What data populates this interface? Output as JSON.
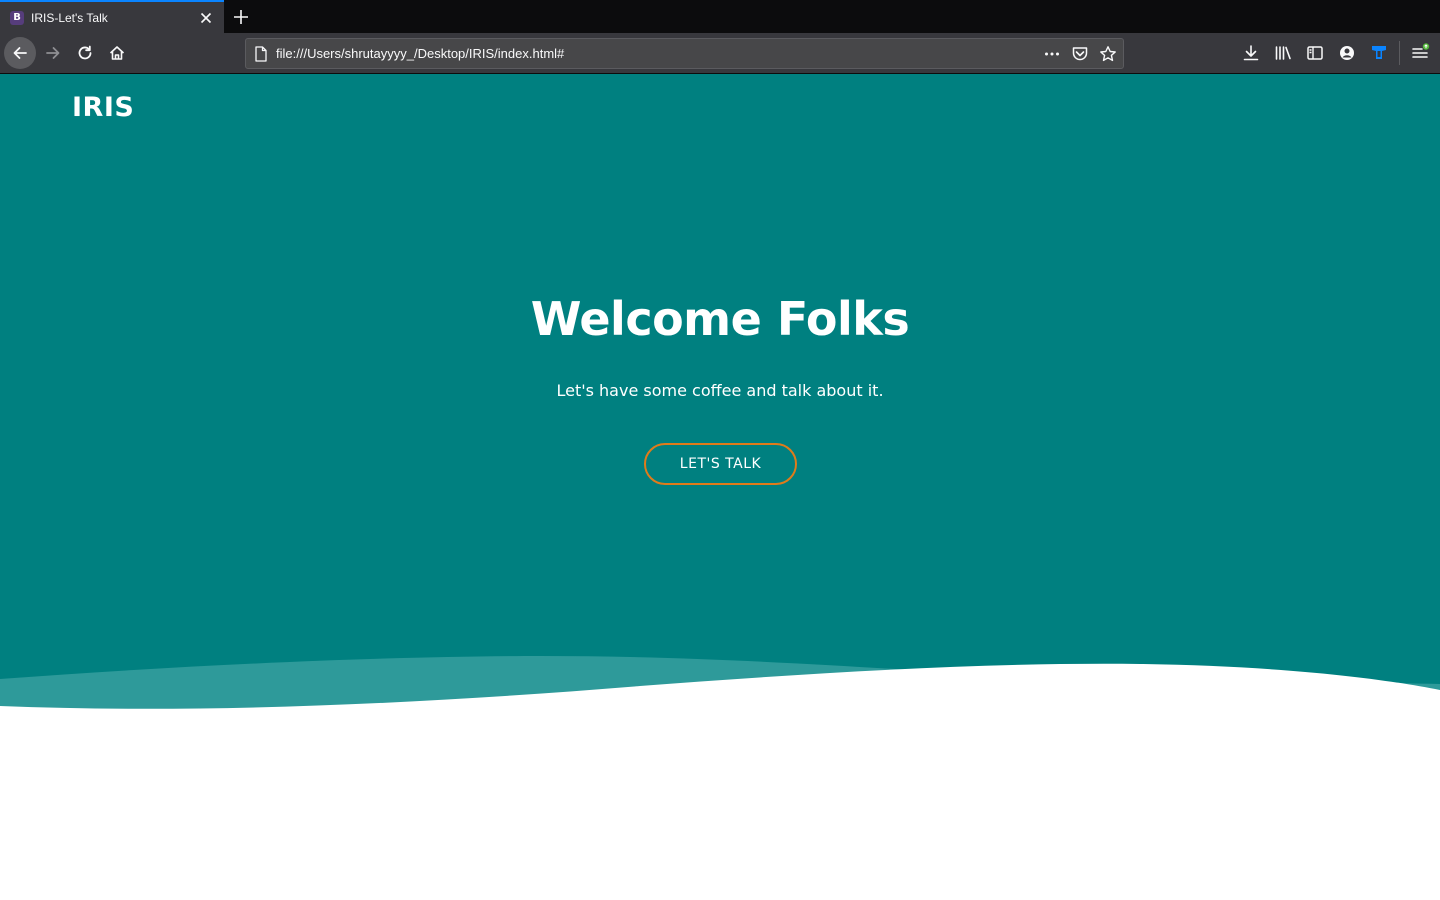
{
  "browser": {
    "tab": {
      "favicon_letter": "B",
      "title": "IRIS-Let's Talk"
    },
    "url": "file:///Users/shrutayyyy_/Desktop/IRIS/index.html#",
    "icons": {
      "tab_close": "close-icon",
      "new_tab": "plus-icon",
      "back": "arrow-left-icon",
      "forward": "arrow-right-icon",
      "reload": "reload-icon",
      "home": "home-icon",
      "page": "page-icon",
      "more": "ellipsis-icon",
      "pocket": "pocket-icon",
      "bookmark": "star-icon",
      "downloads": "download-icon",
      "library": "library-icon",
      "sidebar": "sidebar-icon",
      "account": "account-icon",
      "extension": "shield-extension-icon",
      "menu": "hamburger-menu-icon"
    }
  },
  "page": {
    "brand": "IRIS",
    "headline": "Welcome Folks",
    "subtitle": "Let's have some coffee and talk about it.",
    "cta_label": "LET'S TALK"
  },
  "colors": {
    "hero_bg": "#008080",
    "cta_border": "#e07b1a",
    "wave_light": "#3a9e9e",
    "page_bg": "#ffffff",
    "toolbar_bg": "#38383d",
    "tabstrip_bg": "#0c0c0d",
    "tab_accent": "#0a84ff"
  }
}
